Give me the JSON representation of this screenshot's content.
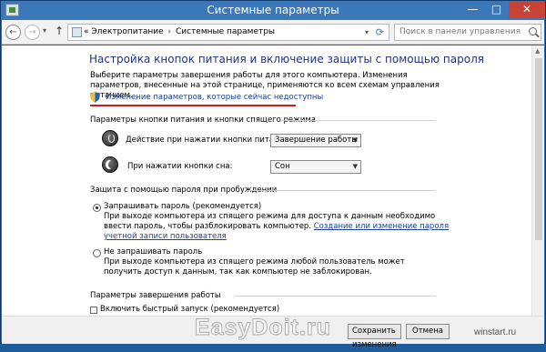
{
  "window": {
    "title": "Системные параметры",
    "controls": {
      "minimize": "—",
      "maximize": "□",
      "close": "✕"
    }
  },
  "navbar": {
    "back_icon": "arrow-left-icon",
    "forward_icon": "arrow-right-icon",
    "up_icon": "arrow-up-icon",
    "breadcrumb": {
      "prefix": "«",
      "items": [
        "Электропитание",
        "Системные параметры"
      ],
      "separator": "›"
    },
    "search_placeholder": "Поиск в панели управления"
  },
  "main": {
    "title": "Настройка кнопок питания и включение защиты с помощью пароля",
    "intro": "Выберите параметры завершения работы для этого компьютера. Изменения параметров, внесенные на этой странице, применяются ко всем схемам управления питанием.",
    "unavailable_link": "Изменение параметров, которые сейчас недоступны",
    "power_section": {
      "heading": "Параметры кнопки питания и кнопки спящего режима",
      "rows": [
        {
          "label": "Действие при нажатии кнопки питания:",
          "value": "Завершение работы"
        },
        {
          "label": "При нажатии кнопки сна:",
          "value": "Сон"
        }
      ]
    },
    "password_section": {
      "heading": "Защита с помощью пароля при пробуждении",
      "options": [
        {
          "label": "Запрашивать пароль (рекомендуется)",
          "desc": "При выходе компьютера из спящего режима для доступа к данным необходимо ввести пароль, чтобы разблокировать компьютер.",
          "link": "Создание или изменение пароля учетной записи пользователя",
          "selected": true
        },
        {
          "label": "Не запрашивать пароль",
          "desc": "При выходе компьютера из спящего режима любой пользователь может получить доступ к данным, так как компьютер не заблокирован.",
          "selected": false
        }
      ]
    },
    "shutdown_section": {
      "heading": "Параметры завершения работы",
      "checkbox_label": "Включить быстрый запуск (рекомендуется)"
    }
  },
  "buttons": {
    "save": "Сохранить изменения",
    "cancel": "Отмена"
  },
  "overlay": {
    "watermark": "EasyDoit.ru",
    "site": "winstart.ru"
  },
  "colors": {
    "title_bar": "#3b78b9",
    "heading": "#1e3287",
    "link": "#1a3f9c",
    "highlight": "#c81e1e"
  }
}
